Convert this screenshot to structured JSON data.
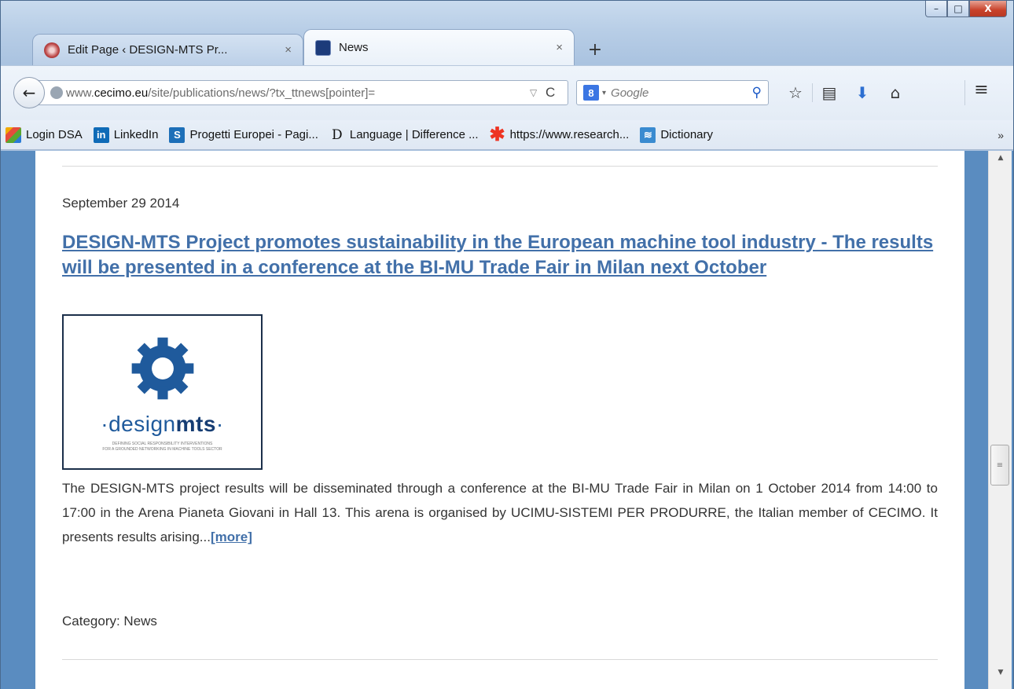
{
  "window": {
    "controls": {
      "minimize": "–",
      "maximize": "□",
      "close": "X"
    }
  },
  "tabs": [
    {
      "title": "Edit Page ‹ DESIGN-MTS Pr...",
      "close": "×"
    },
    {
      "title": "News",
      "close": "×"
    }
  ],
  "new_tab": "+",
  "navbar": {
    "back": "←",
    "url_prefix": "www.",
    "url_domain": "cecimo.eu",
    "url_path": "/site/publications/news/?tx_ttnews[pointer]=",
    "dropdown": "▽",
    "reload": "C",
    "search_engine_icon": "8",
    "search_caret": "▾",
    "search_placeholder": "Google",
    "search_icon": "⚲",
    "icons": {
      "bookmark_star": "☆",
      "reading_list": "▤",
      "download": "⬇",
      "home": "⌂",
      "menu": "≡"
    }
  },
  "bookmarks": [
    {
      "label": "Login DSA",
      "icon": ""
    },
    {
      "label": "LinkedIn",
      "icon": "in"
    },
    {
      "label": "Progetti Europei - Pagi...",
      "icon": "S"
    },
    {
      "label": "Language | Difference ...",
      "icon": "D"
    },
    {
      "label": "https://www.research...",
      "icon": "✱"
    },
    {
      "label": "Dictionary",
      "icon": "≋"
    }
  ],
  "bookmarks_more": "»",
  "article": {
    "date": "September 29 2014",
    "headline": "DESIGN-MTS Project promotes sustainability in the European machine tool industry - The results will be presented in a conference at the BI-MU Trade Fair in Milan next October",
    "logo": {
      "text_pre": "·design",
      "text_bold": "mts",
      "text_post": "·",
      "subtitle_1": "DEFINING SOCIAL RESPONSIBILITY INTERVENTIONS",
      "subtitle_2": "FOR A GROUNDED NETWORKING IN MACHINE TOOLS SECTOR"
    },
    "body": "The DESIGN-MTS project results will be disseminated through a conference at the BI-MU Trade Fair in Milan on 1 October 2014 from 14:00 to 17:00 in the Arena Pianeta Giovani in Hall 13. This arena is organised by UCIMU-SISTEMI PER PRODURRE, the Italian member of CECIMO. It presents results arising...",
    "more": "[more]",
    "category": "Category: News"
  },
  "scrollbar": {
    "up": "▲",
    "down": "▼",
    "grip": "≡"
  },
  "colors": {
    "link": "#4270a9",
    "page_bg": "#5a8cc0"
  }
}
